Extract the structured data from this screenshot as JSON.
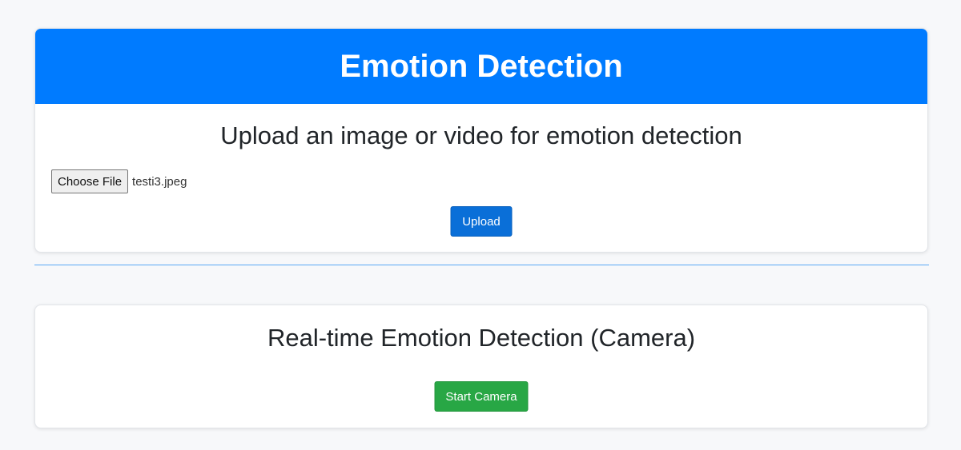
{
  "header": {
    "title": "Emotion Detection",
    "background_color": "#007bff"
  },
  "upload_section": {
    "heading": "Upload an image or video for emotion detection",
    "choose_file_label": "Choose File",
    "selected_file_name": "testi3.jpeg",
    "upload_button_label": "Upload",
    "upload_button_color": "#0a6fd8"
  },
  "camera_section": {
    "heading": "Real-time Emotion Detection (Camera)",
    "start_button_label": "Start Camera",
    "start_button_color": "#28a745"
  }
}
